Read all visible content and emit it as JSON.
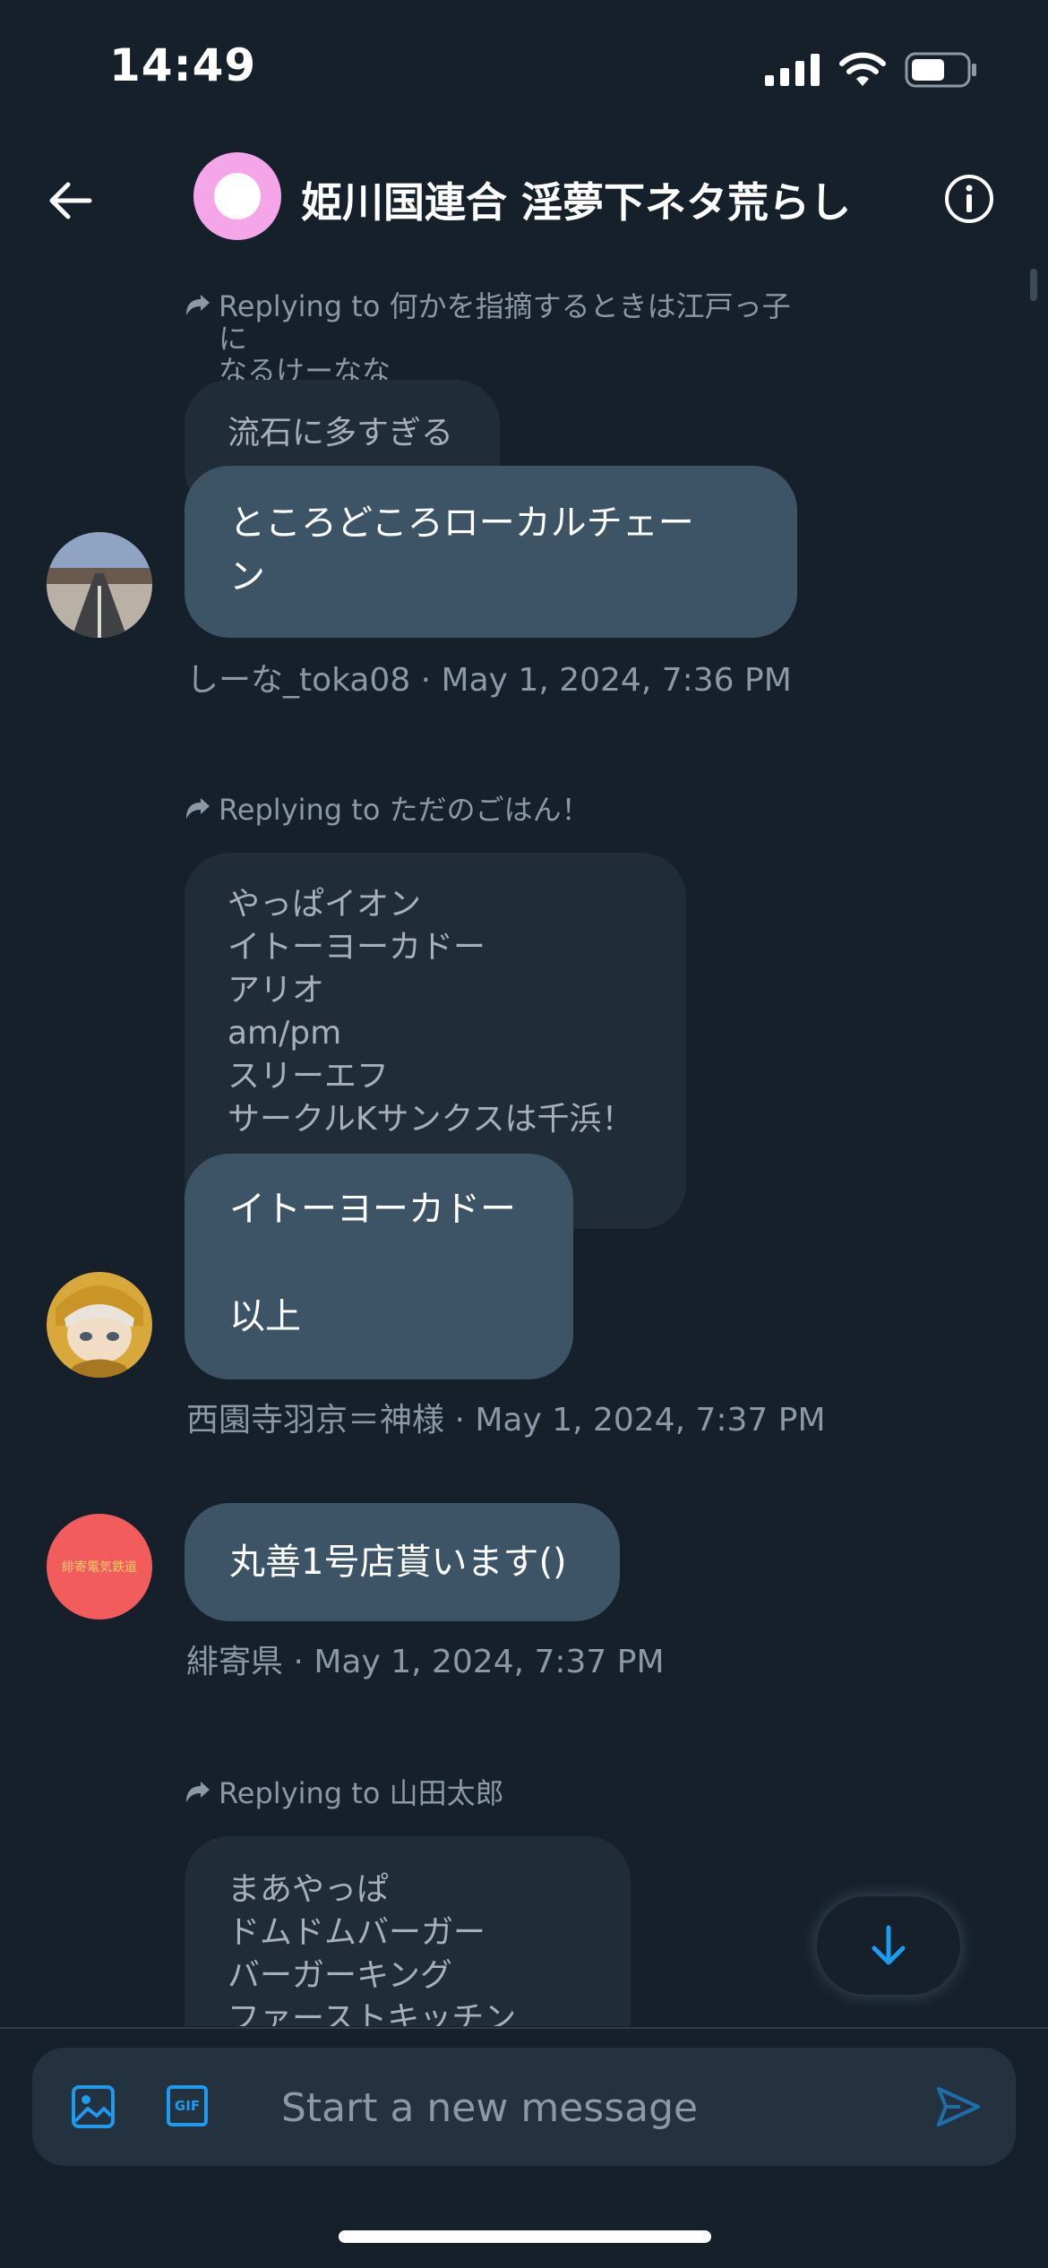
{
  "status_bar": {
    "time": "14:49"
  },
  "header": {
    "title": "姫川国連合 淫夢下ネタ荒らし",
    "back_icon": "arrow-left-icon",
    "info_icon": "info-icon"
  },
  "messages": [
    {
      "reply_prefix": "Replying to",
      "reply_to_line1": "何かを指摘するときは江戸っ子に",
      "reply_to_line2": "なるけーなな",
      "quoted_line1": "流石に多すぎる",
      "text_line1": "ところどころローカルチェー",
      "text_line2": "ン",
      "meta": "しーな_toka08 · May 1, 2024, 7:36 PM"
    },
    {
      "reply_prefix": "Replying to",
      "reply_to": "ただのごはん！",
      "quoted_lines": [
        "やっぱイオン",
        "イトーヨーカドー",
        "アリオ",
        "am/pm",
        "スリーエフ",
        "サークルKサンクスは千浜！"
      ],
      "text_line1": "イトーヨーカドー",
      "text_line2": "以上",
      "meta": "西園寺羽京＝神様 · May 1, 2024, 7:37 PM"
    },
    {
      "text": "丸善1号店貰います()",
      "meta": "緋寄県 · May 1, 2024, 7:37 PM",
      "avatar_text": "緋寄電気鉄道"
    },
    {
      "reply_prefix": "Replying to",
      "reply_to": "山田太郎",
      "quoted_lines": [
        "まあやっぱ",
        "ドムドムバーガー",
        "バーガーキング",
        "ファーストキッチン"
      ]
    }
  ],
  "composer": {
    "placeholder": "Start a new message",
    "image_icon": "image-icon",
    "gif_label": "GIF",
    "send_icon": "send-icon"
  },
  "colors": {
    "background": "#15202b",
    "bubble": "#3d5466",
    "quoted_bubble": "#212c39",
    "accent": "#1d9bf0",
    "muted_text": "#8b98a5"
  }
}
